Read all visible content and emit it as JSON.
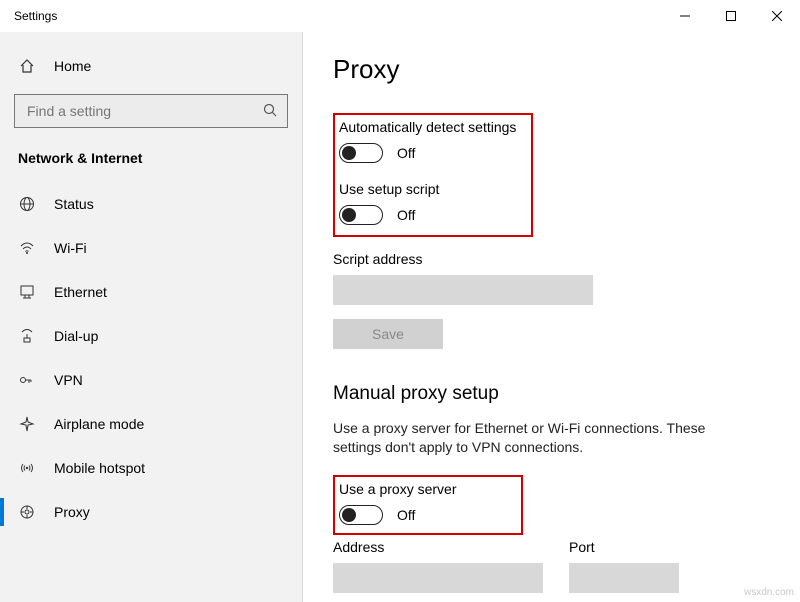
{
  "window": {
    "title": "Settings"
  },
  "sidebar": {
    "home_label": "Home",
    "search_placeholder": "Find a setting",
    "category": "Network & Internet",
    "items": [
      {
        "label": "Status"
      },
      {
        "label": "Wi-Fi"
      },
      {
        "label": "Ethernet"
      },
      {
        "label": "Dial-up"
      },
      {
        "label": "VPN"
      },
      {
        "label": "Airplane mode"
      },
      {
        "label": "Mobile hotspot"
      },
      {
        "label": "Proxy"
      }
    ]
  },
  "page": {
    "title": "Proxy",
    "auto_detect_label": "Automatically detect settings",
    "auto_detect_state": "Off",
    "setup_script_label": "Use setup script",
    "setup_script_state": "Off",
    "script_address_label": "Script address",
    "save_label": "Save",
    "manual_title": "Manual proxy setup",
    "manual_hint": "Use a proxy server for Ethernet or Wi-Fi connections. These settings don't apply to VPN connections.",
    "use_proxy_label": "Use a proxy server",
    "use_proxy_state": "Off",
    "address_label": "Address",
    "port_label": "Port"
  },
  "watermark": "wsxdn.com"
}
